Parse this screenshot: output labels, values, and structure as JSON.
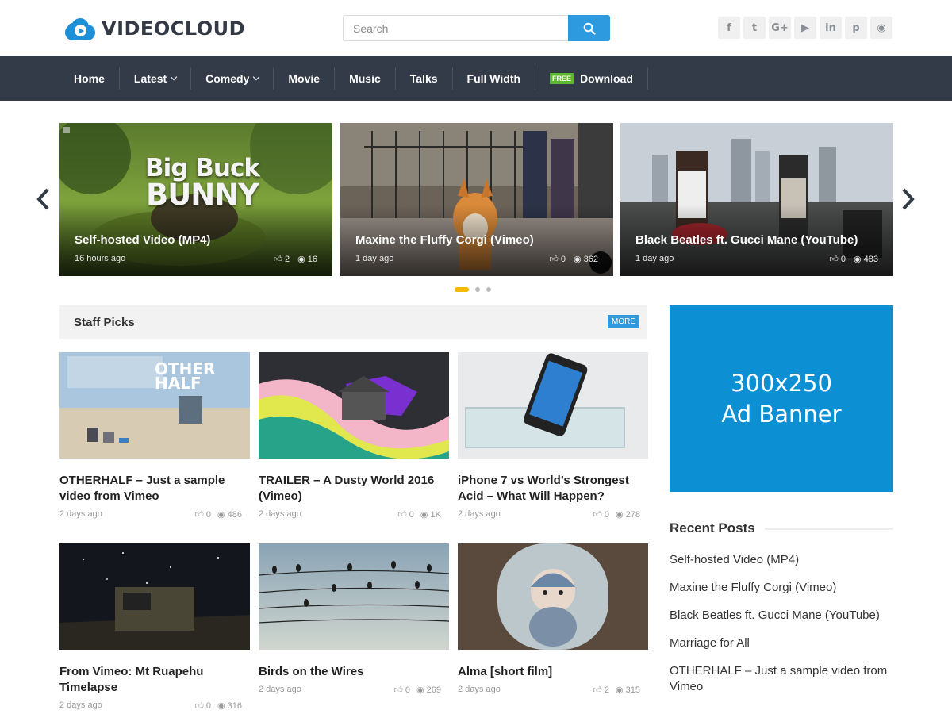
{
  "site": {
    "name": "VIDEOCLOUD"
  },
  "search": {
    "placeholder": "Search"
  },
  "social": [
    {
      "icon": "facebook-icon",
      "glyph": "f"
    },
    {
      "icon": "twitter-icon",
      "glyph": "t"
    },
    {
      "icon": "google-plus-icon",
      "glyph": "G+"
    },
    {
      "icon": "youtube-icon",
      "glyph": "▶"
    },
    {
      "icon": "linkedin-icon",
      "glyph": "in"
    },
    {
      "icon": "pinterest-icon",
      "glyph": "p"
    },
    {
      "icon": "rss-icon",
      "glyph": "◉"
    }
  ],
  "nav": {
    "items": [
      {
        "label": "Home"
      },
      {
        "label": "Latest"
      },
      {
        "label": "Comedy"
      },
      {
        "label": "Movie"
      },
      {
        "label": "Music"
      },
      {
        "label": "Talks"
      },
      {
        "label": "Full Width"
      },
      {
        "badge": "FREE",
        "label": "Download"
      }
    ]
  },
  "slider": {
    "slides": [
      {
        "title": "Self-hosted Video (MP4)",
        "date": "16 hours ago",
        "likes": "2",
        "views": "16",
        "overlay": "Big Buck BUNNY"
      },
      {
        "title": "Maxine the Fluffy Corgi (Vimeo)",
        "date": "1 day ago",
        "likes": "0",
        "views": "362"
      },
      {
        "title": "Black Beatles ft. Gucci Mane (YouTube)",
        "date": "1 day ago",
        "likes": "0",
        "views": "483"
      }
    ],
    "dots": 3,
    "active_dot": 1
  },
  "staff_picks": {
    "title": "Staff Picks",
    "more_label": "MORE",
    "cards": [
      {
        "title": "OTHERHALF – Just a sample video from Vimeo",
        "date": "2 days ago",
        "likes": "0",
        "views": "486"
      },
      {
        "title": "TRAILER – A Dusty World 2016 (Vimeo)",
        "date": "2 days ago",
        "likes": "0",
        "views": "1K"
      },
      {
        "title": "iPhone 7 vs World’s Strongest Acid – What Will Happen?",
        "date": "2 days ago",
        "likes": "0",
        "views": "278"
      },
      {
        "title": "From Vimeo: Mt Ruapehu Timelapse",
        "date": "2 days ago",
        "likes": "0",
        "views": "316"
      },
      {
        "title": "Birds on the Wires",
        "date": "2 days ago",
        "likes": "0",
        "views": "269"
      },
      {
        "title": "Alma [short film]",
        "date": "2 days ago",
        "likes": "2",
        "views": "315"
      }
    ]
  },
  "ad": {
    "line1": "300x250",
    "line2": "Ad Banner"
  },
  "recent_posts": {
    "title": "Recent Posts",
    "items": [
      "Self-hosted Video (MP4)",
      "Maxine the Fluffy Corgi (Vimeo)",
      "Black Beatles ft. Gucci Mane (YouTube)",
      "Marriage for All",
      "OTHERHALF – Just a sample video from Vimeo"
    ]
  },
  "colors": {
    "accent": "#2d9ae0",
    "nav_bg": "#333a48",
    "ad_bg": "#0d8fd4",
    "dot_active": "#f6b800",
    "free_badge": "#5cb82e"
  }
}
